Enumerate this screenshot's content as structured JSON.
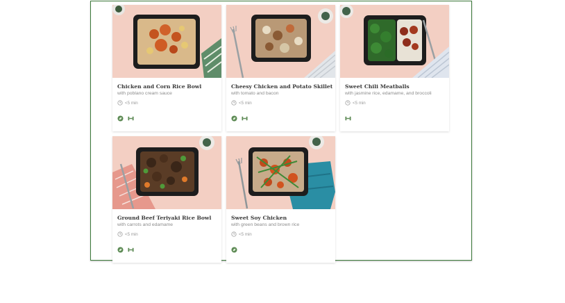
{
  "colors": {
    "frame_border": "#3d7a3b",
    "photo_background": "#f3cfc3",
    "badge_green": "#5d8a55"
  },
  "meals": [
    {
      "title": "Chicken and Corn Rice Bowl",
      "subtitle": "with poblano cream sauce",
      "time": "<5 min",
      "badges": [
        "leaf-icon",
        "dumbbell-icon"
      ]
    },
    {
      "title": "Cheesy Chicken and Potato Skillet",
      "subtitle": "with tomato and bacon",
      "time": "<5 min",
      "badges": [
        "leaf-icon",
        "dumbbell-icon"
      ]
    },
    {
      "title": "Sweet Chili Meatballs",
      "subtitle": "with jasmine rice, edamame, and broccoli",
      "time": "<5 min",
      "badges": [
        "dumbbell-icon"
      ]
    },
    {
      "title": "Ground Beef Teriyaki Rice Bowl",
      "subtitle": "with carrots and edamame",
      "time": "<5 min",
      "badges": [
        "leaf-icon",
        "dumbbell-icon"
      ]
    },
    {
      "title": "Sweet Soy Chicken",
      "subtitle": "with green beans and brown rice",
      "time": "<5 min",
      "badges": [
        "leaf-icon"
      ]
    }
  ]
}
